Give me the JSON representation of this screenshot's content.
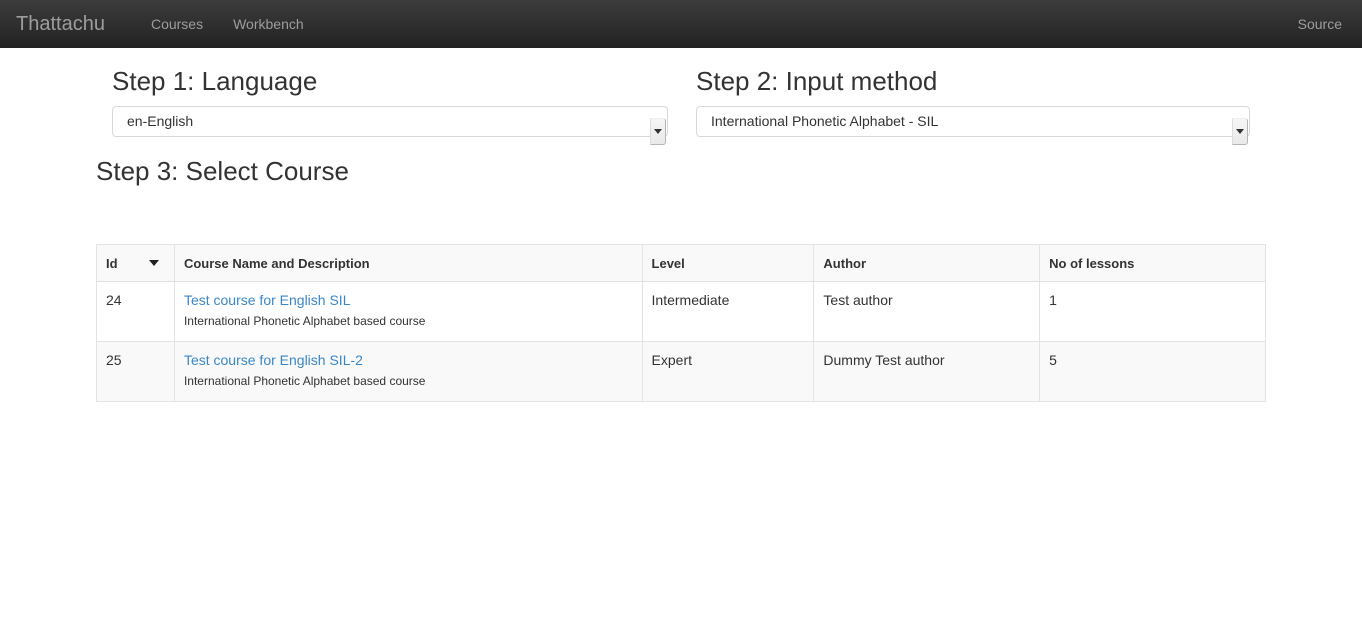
{
  "navbar": {
    "brand": "Thattachu",
    "links": [
      {
        "label": "Courses"
      },
      {
        "label": "Workbench"
      }
    ],
    "right_link": "Source"
  },
  "steps": {
    "step1": {
      "heading": "Step 1: Language",
      "selected": "en-English"
    },
    "step2": {
      "heading": "Step 2: Input method",
      "selected": "International Phonetic Alphabet - SIL"
    },
    "step3": {
      "heading": "Step 3: Select Course"
    }
  },
  "table": {
    "headers": {
      "id": "Id",
      "name": "Course Name and Description",
      "level": "Level",
      "author": "Author",
      "lessons": "No of lessons"
    },
    "rows": [
      {
        "id": "24",
        "name": "Test course for English SIL",
        "description": "International Phonetic Alphabet based course",
        "level": "Intermediate",
        "author": "Test author",
        "lessons": "1"
      },
      {
        "id": "25",
        "name": "Test course for English SIL-2",
        "description": "International Phonetic Alphabet based course",
        "level": "Expert",
        "author": "Dummy Test author",
        "lessons": "5"
      }
    ]
  },
  "colors": {
    "navbar_top": "#3c3c3c",
    "navbar_bottom": "#222222",
    "link_blue": "#3a87c8",
    "text": "#333333",
    "nav_text": "#9d9d9d",
    "table_border": "#e3e3e3",
    "stripe": "#f9f9f9"
  }
}
